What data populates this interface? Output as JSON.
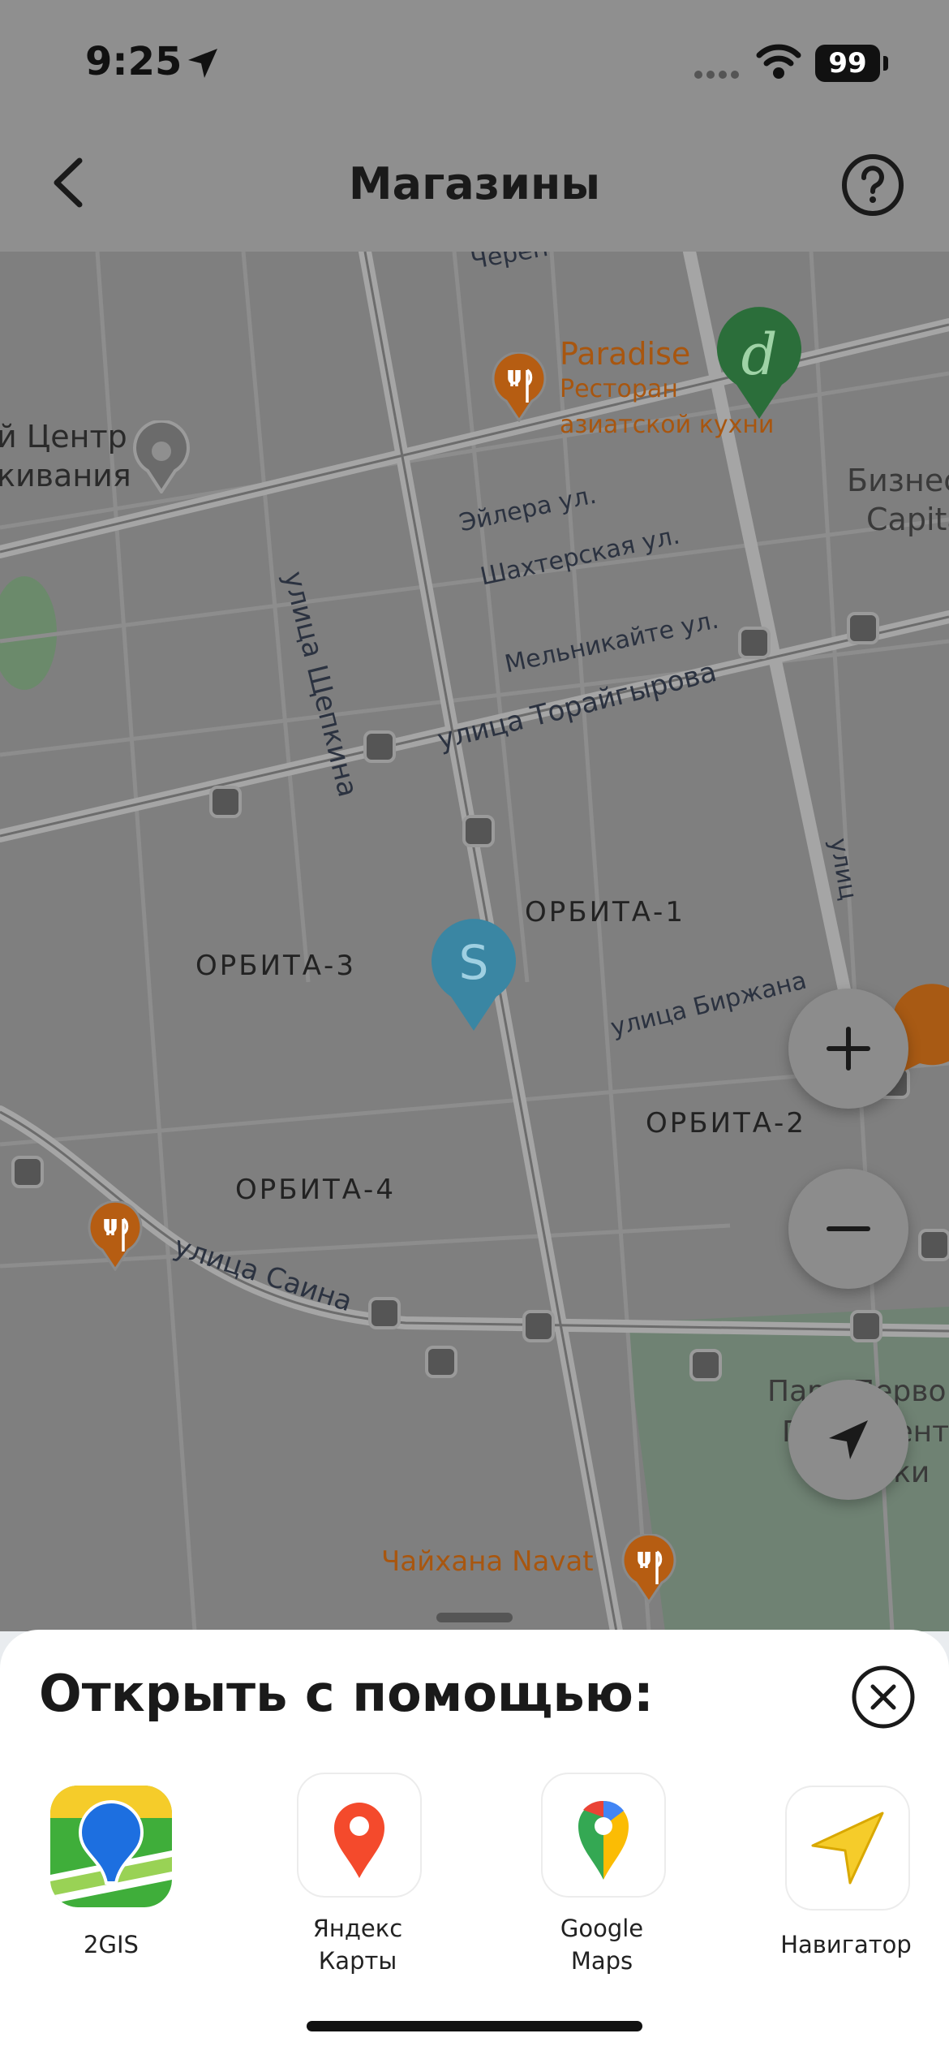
{
  "status_bar": {
    "time": "9:25",
    "battery": "99"
  },
  "header": {
    "title": "Магазины"
  },
  "map": {
    "streets": [
      "Череп",
      "Эйлера ул.",
      "Шахтерская ул.",
      "Мельникайте ул.",
      "улица Торайгырова",
      "улица Щепкина",
      "улица Биржана",
      "улица Саина",
      "улиц"
    ],
    "districts": [
      "ОРБИТА-1",
      "ОРБИТА-2",
      "ОРБИТА-3",
      "ОРБИТА-4"
    ],
    "pois": {
      "paradise_name": "Paradise",
      "paradise_desc_1": "Ресторан",
      "paradise_desc_2": "азиатской кухни",
      "chaihana": "Чайхана Navat",
      "center_1": "й Центр",
      "center_2": "кивания",
      "business_1": "Бизнес",
      "business_2": "Capita",
      "park_1": "Парк Перво",
      "park_2": "Президент",
      "park_3": "твинки"
    },
    "markers": {
      "store_s": "S",
      "store_d": "d"
    }
  },
  "sheet": {
    "title": "Открыть с помощью:",
    "apps": [
      {
        "line1": "2GIS",
        "line2": ""
      },
      {
        "line1": "Яндекс",
        "line2": "Карты"
      },
      {
        "line1": "Google",
        "line2": "Maps"
      },
      {
        "line1": "Навигатор",
        "line2": ""
      }
    ]
  },
  "colors": {
    "yandex_red": "#f44a2c",
    "gis_green": "#3fae3a",
    "gis_blue": "#1d6fe0",
    "navigator_yellow": "#f5cc2a",
    "store_teal": "#3a86a3",
    "store_green": "#2b6e3a",
    "poi_orange": "#b65d12"
  }
}
